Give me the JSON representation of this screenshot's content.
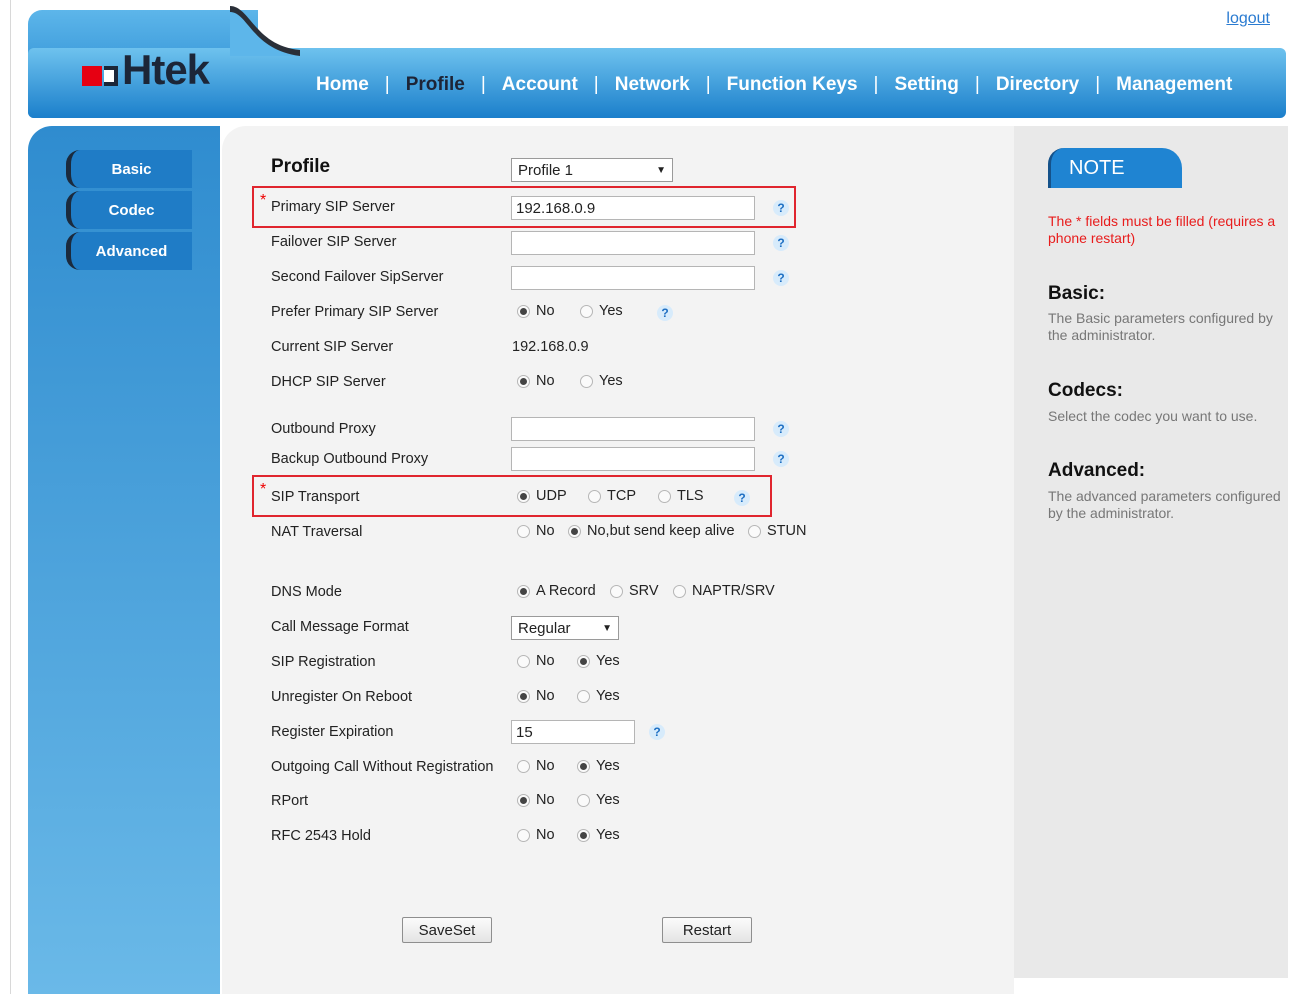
{
  "header": {
    "logout": "logout",
    "logo_text": "Htek",
    "nav": [
      "Home",
      "Profile",
      "Account",
      "Network",
      "Function Keys",
      "Setting",
      "Directory",
      "Management"
    ],
    "nav_active": "Profile"
  },
  "sidebar": {
    "items": [
      "Basic",
      "Codec",
      "Advanced"
    ]
  },
  "form": {
    "title": "Profile",
    "profile_select": "Profile 1",
    "primary_sip_server": {
      "label": "Primary SIP Server",
      "value": "192.168.0.9"
    },
    "failover_sip_server": {
      "label": "Failover SIP Server",
      "value": ""
    },
    "second_failover": {
      "label": "Second Failover SipServer",
      "value": ""
    },
    "prefer_primary": {
      "label": "Prefer Primary SIP Server",
      "options": [
        "No",
        "Yes"
      ],
      "selected": "No"
    },
    "current_sip_server": {
      "label": "Current SIP Server",
      "value": "192.168.0.9"
    },
    "dhcp_sip_server": {
      "label": "DHCP SIP Server",
      "options": [
        "No",
        "Yes"
      ],
      "selected": "No"
    },
    "outbound_proxy": {
      "label": "Outbound Proxy",
      "value": ""
    },
    "backup_outbound_proxy": {
      "label": "Backup Outbound Proxy",
      "value": ""
    },
    "sip_transport": {
      "label": "SIP Transport",
      "options": [
        "UDP",
        "TCP",
        "TLS"
      ],
      "selected": "UDP"
    },
    "nat_traversal": {
      "label": "NAT Traversal",
      "options": [
        "No",
        "No,but send keep alive",
        "STUN"
      ],
      "selected": "No,but send keep alive"
    },
    "dns_mode": {
      "label": "DNS Mode",
      "options": [
        "A Record",
        "SRV",
        "NAPTR/SRV"
      ],
      "selected": "A Record"
    },
    "call_message_format": {
      "label": "Call Message Format",
      "value": "Regular"
    },
    "sip_registration": {
      "label": "SIP Registration",
      "options": [
        "No",
        "Yes"
      ],
      "selected": "Yes"
    },
    "unregister_on_reboot": {
      "label": "Unregister On Reboot",
      "options": [
        "No",
        "Yes"
      ],
      "selected": "No"
    },
    "register_expiration": {
      "label": "Register Expiration",
      "value": "15"
    },
    "outgoing_call": {
      "label": "Outgoing Call Without Registration",
      "options": [
        "No",
        "Yes"
      ],
      "selected": "Yes"
    },
    "rport": {
      "label": "RPort",
      "options": [
        "No",
        "Yes"
      ],
      "selected": "No"
    },
    "rfc2543_hold": {
      "label": "RFC 2543 Hold",
      "options": [
        "No",
        "Yes"
      ],
      "selected": "Yes"
    },
    "saveset": "SaveSet",
    "restart": "Restart"
  },
  "note": {
    "badge": "NOTE",
    "required": "The * fields must be filled (requires a phone restart)",
    "sections": [
      {
        "title": "Basic:",
        "text": "The Basic parameters configured by the administrator."
      },
      {
        "title": "Codecs:",
        "text": "Select the codec you want to use."
      },
      {
        "title": "Advanced:",
        "text": "The advanced parameters configured by the administrator."
      }
    ]
  },
  "colors": {
    "accent": "#1f7cc6",
    "highlight_box": "#e0252e",
    "note_red": "#e81c1c"
  }
}
